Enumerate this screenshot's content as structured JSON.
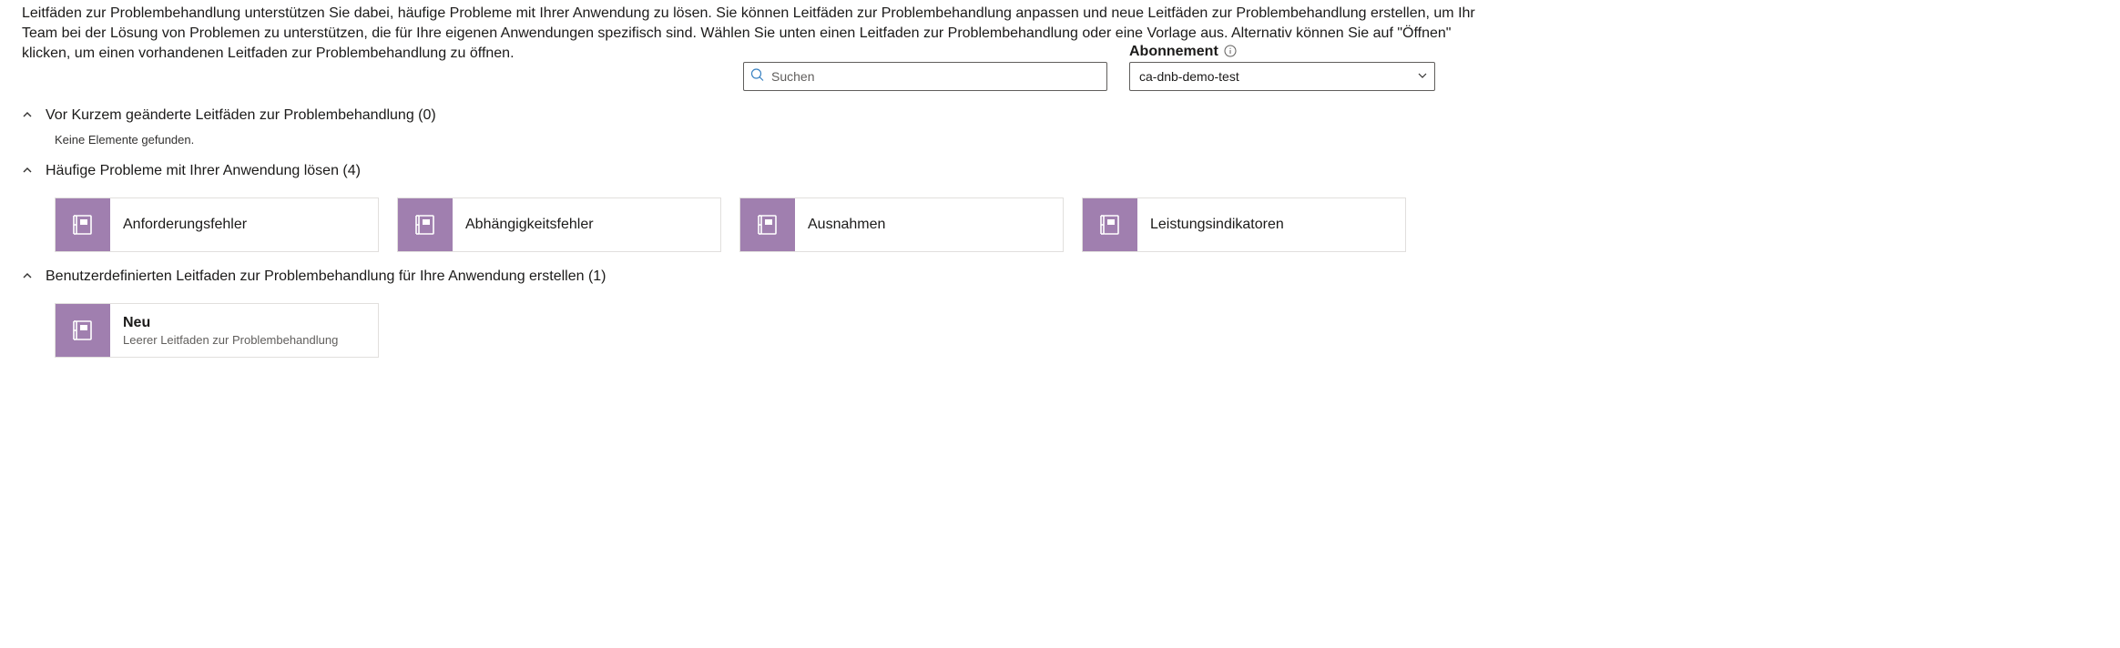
{
  "intro": "Leitfäden zur Problembehandlung unterstützen Sie dabei, häufige Probleme mit Ihrer Anwendung zu lösen. Sie können Leitfäden zur Problembehandlung anpassen und neue Leitfäden zur Problembehandlung erstellen, um Ihr Team bei der Lösung von Problemen zu unterstützen, die für Ihre eigenen Anwendungen spezifisch sind. Wählen Sie unten einen Leitfaden zur Problembehandlung oder eine Vorlage aus. Alternativ können Sie auf \"Öffnen\" klicken, um einen vorhandenen Leitfaden zur Problembehandlung zu öffnen.",
  "search": {
    "placeholder": "Suchen"
  },
  "subscription": {
    "label": "Abonnement",
    "value": "ca-dnb-demo-test"
  },
  "sections": {
    "recent": {
      "title": "Vor Kurzem geänderte Leitfäden zur Problembehandlung (0)",
      "empty": "Keine Elemente gefunden."
    },
    "common": {
      "title": "Häufige Probleme mit Ihrer Anwendung lösen (4)",
      "cards": [
        {
          "title": "Anforderungsfehler"
        },
        {
          "title": "Abhängigkeitsfehler"
        },
        {
          "title": "Ausnahmen"
        },
        {
          "title": "Leistungsindikatoren"
        }
      ]
    },
    "custom": {
      "title": "Benutzerdefinierten Leitfaden zur Problembehandlung für Ihre Anwendung erstellen (1)",
      "cards": [
        {
          "title": "Neu",
          "subtitle": "Leerer Leitfaden zur Problembehandlung"
        }
      ]
    }
  }
}
